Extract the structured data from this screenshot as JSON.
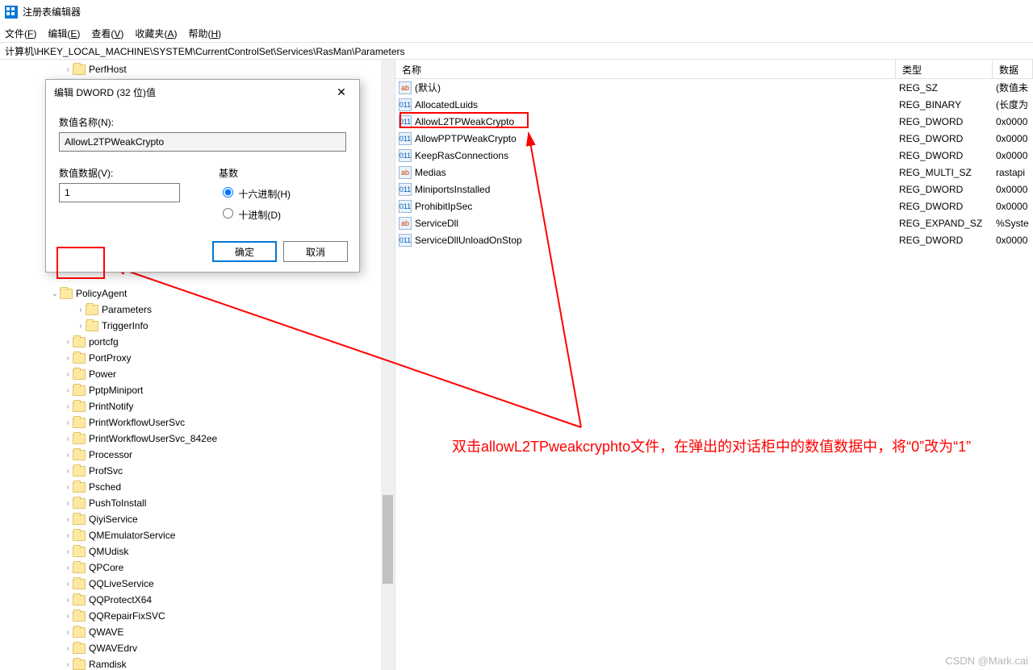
{
  "window": {
    "title": "注册表编辑器"
  },
  "menu": {
    "file": {
      "label": "文件",
      "accel": "F"
    },
    "edit": {
      "label": "编辑",
      "accel": "E"
    },
    "view": {
      "label": "查看",
      "accel": "V"
    },
    "fav": {
      "label": "收藏夹",
      "accel": "A"
    },
    "help": {
      "label": "帮助",
      "accel": "H"
    }
  },
  "address": "计算机\\HKEY_LOCAL_MACHINE\\SYSTEM\\CurrentControlSet\\Services\\RasMan\\Parameters",
  "tree": {
    "top": "PerfHost",
    "policyAgent": "PolicyAgent",
    "pa_child1": "Parameters",
    "pa_child2": "TriggerInfo",
    "items": [
      "portcfg",
      "PortProxy",
      "Power",
      "PptpMiniport",
      "PrintNotify",
      "PrintWorkflowUserSvc",
      "PrintWorkflowUserSvc_842ee",
      "Processor",
      "ProfSvc",
      "Psched",
      "PushToInstall",
      "QiyiService",
      "QMEmulatorService",
      "QMUdisk",
      "QPCore",
      "QQLiveService",
      "QQProtectX64",
      "QQRepairFixSVC",
      "QWAVE",
      "QWAVEdrv",
      "Ramdisk"
    ]
  },
  "columns": {
    "name": "名称",
    "type": "类型",
    "data": "数据"
  },
  "rows": [
    {
      "name": "(默认)",
      "type": "REG_SZ",
      "data": "(数值未",
      "kind": "str"
    },
    {
      "name": "AllocatedLuids",
      "type": "REG_BINARY",
      "data": "(长度为",
      "kind": "bin"
    },
    {
      "name": "AllowL2TPWeakCrypto",
      "type": "REG_DWORD",
      "data": "0x0000",
      "kind": "bin"
    },
    {
      "name": "AllowPPTPWeakCrypto",
      "type": "REG_DWORD",
      "data": "0x0000",
      "kind": "bin"
    },
    {
      "name": "KeepRasConnections",
      "type": "REG_DWORD",
      "data": "0x0000",
      "kind": "bin"
    },
    {
      "name": "Medias",
      "type": "REG_MULTI_SZ",
      "data": "rastapi",
      "kind": "str"
    },
    {
      "name": "MiniportsInstalled",
      "type": "REG_DWORD",
      "data": "0x0000",
      "kind": "bin"
    },
    {
      "name": "ProhibitIpSec",
      "type": "REG_DWORD",
      "data": "0x0000",
      "kind": "bin"
    },
    {
      "name": "ServiceDll",
      "type": "REG_EXPAND_SZ",
      "data": "%Syste",
      "kind": "str"
    },
    {
      "name": "ServiceDllUnloadOnStop",
      "type": "REG_DWORD",
      "data": "0x0000",
      "kind": "bin"
    }
  ],
  "dialog": {
    "title": "编辑 DWORD (32 位)值",
    "name_label": "数值名称(N):",
    "name_value": "AllowL2TPWeakCrypto",
    "data_label": "数值数据(V):",
    "data_value": "1",
    "base_label": "基数",
    "radix_hex": "十六进制(H)",
    "radix_dec": "十进制(D)",
    "ok": "确定",
    "cancel": "取消"
  },
  "annotation": "双击allowL2TPweakcryphto文件，在弹出的对话柜中的数值数据中，将“0”改为“1”",
  "watermark": "CSDN @Mark.cai"
}
